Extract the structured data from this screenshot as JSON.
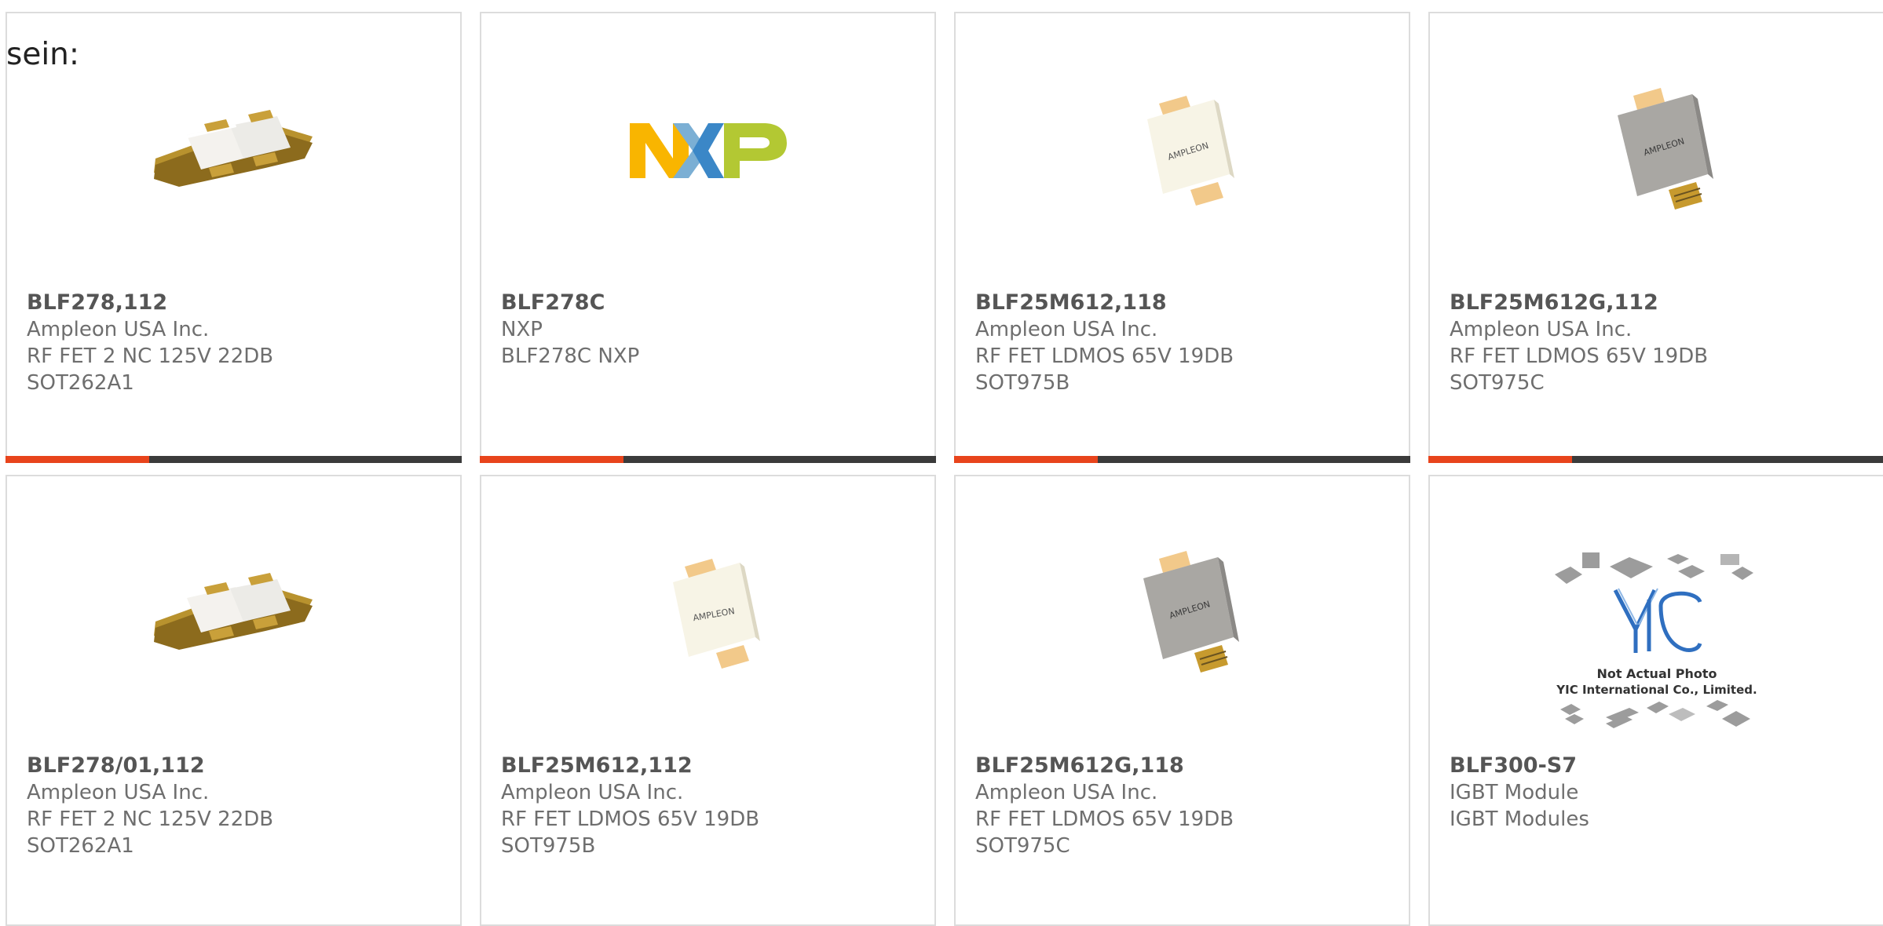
{
  "header": {
    "label": "sein:"
  },
  "products": [
    {
      "part": "BLF278,112",
      "maker": "Ampleon USA Inc.",
      "desc": "RF FET 2 NC 125V 22DB",
      "pkg": "SOT262A1",
      "image": "flange-transistor"
    },
    {
      "part": "BLF278C",
      "maker": "NXP",
      "desc": "BLF278C NXP",
      "pkg": "",
      "image": "nxp-logo"
    },
    {
      "part": "BLF25M612,118",
      "maker": "Ampleon USA Inc.",
      "desc": "RF FET LDMOS 65V 19DB",
      "pkg": "SOT975B",
      "image": "ampleon-white"
    },
    {
      "part": "BLF25M612G,112",
      "maker": "Ampleon USA Inc.",
      "desc": "RF FET LDMOS 65V 19DB",
      "pkg": "SOT975C",
      "image": "ampleon-gray"
    },
    {
      "part": "BLF278/01,112",
      "maker": "Ampleon USA Inc.",
      "desc": "RF FET 2 NC 125V 22DB",
      "pkg": "SOT262A1",
      "image": "flange-transistor"
    },
    {
      "part": "BLF25M612,112",
      "maker": "Ampleon USA Inc.",
      "desc": "RF FET LDMOS 65V 19DB",
      "pkg": "SOT975B",
      "image": "ampleon-white"
    },
    {
      "part": "BLF25M612G,118",
      "maker": "Ampleon USA Inc.",
      "desc": "RF FET LDMOS 65V 19DB",
      "pkg": "SOT975C",
      "image": "ampleon-gray"
    },
    {
      "part": "BLF300-S7",
      "maker": "IGBT Module",
      "desc": "IGBT Modules",
      "pkg": "",
      "image": "yic-placeholder"
    }
  ],
  "images": {
    "nxp_logo_text": "NXP",
    "ampleon_label": "AMPLEON",
    "yic_line1": "Not Actual Photo",
    "yic_line2": "YIC International Co., Limited."
  },
  "colors": {
    "accent": "#e8441c",
    "bar": "#3b3b3b",
    "card_border": "#dcdcdc"
  }
}
